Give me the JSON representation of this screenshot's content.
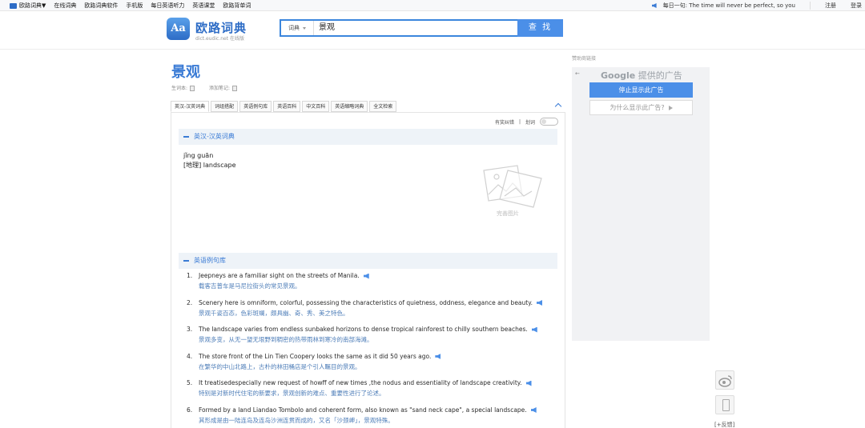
{
  "topbar": {
    "nav": [
      "欧路词典▼",
      "在线词典",
      "欧路词典软件",
      "手机版",
      "每日英语听力",
      "英语课堂",
      "欧路背单词"
    ],
    "daily": "每日一句: The time will never be perfect, so you",
    "register": "注册",
    "login": "登录"
  },
  "brand": {
    "icon_text": "Aa",
    "name": "欧路词典",
    "sub": "dict.eudic.net 在线版"
  },
  "search": {
    "scope": "词典",
    "query": "景观",
    "button": "查 找"
  },
  "word": {
    "title": "景观",
    "wordbook": "生词本:",
    "note": "添加笔记:"
  },
  "tabs": [
    "英汉-汉英词典",
    "词组搭配",
    "英语例句库",
    "英语百科",
    "中文百科",
    "英语缩略词典",
    "全文检索"
  ],
  "panel": {
    "tools": [
      "有奖纠错",
      "|",
      "划词"
    ],
    "section1": "英汉-汉英词典",
    "pinyin": "jǐng guān",
    "definition": "[地理] landscape",
    "pic_label": "完善图片",
    "section2": "英语例句库"
  },
  "examples": [
    {
      "num": "1.",
      "en": "Jeepneys are a familiar sight on the streets of Manila.",
      "zh": "载客吉普车是马尼拉街头的常见景观。"
    },
    {
      "num": "2.",
      "en": "Scenery here is omniform, colorful, possessing the characteristics of quietness, oddness, elegance and beauty.",
      "zh": "景观千姿百态，色彩斑斓，颇具幽、奇、秀、美之特色。"
    },
    {
      "num": "3.",
      "en": "The landscape varies from endless sunbaked horizons to dense tropical rainforest to chilly southern beaches.",
      "zh": "景观多变，从无一望无垠野到稠密的热带雨林到寒冷的南部海滩。"
    },
    {
      "num": "4.",
      "en": "The store front of the Lin Tien Coopery looks the same as it did 50 years ago.",
      "zh": "在繁华的中山北路上，古朴的林田桶店是个引人瞩目的景观。"
    },
    {
      "num": "5.",
      "en": "It treatisedespecially new request of howff of new times ,the nodus and essentiality of landscape creativity.",
      "zh": "特别是对新时代住宅的新要求，景观创新的难点、重要性进行了论述。"
    },
    {
      "num": "6.",
      "en": "Formed by a land Liandao Tombolo and coherent form, also known as \"sand neck cape\", a special landscape.",
      "zh": "其形成是由一陆连岛及连岛沙洲连贯而成的，又名「沙颈岬」，景观特殊。"
    }
  ],
  "ad": {
    "label": "赞助商链接",
    "back": "←",
    "google": "Google",
    "provided": " 提供的广告",
    "stop": "停止显示此广告",
    "why": "为什么显示此广告?"
  },
  "side": {
    "feedback": "[+反馈]"
  },
  "colors": {
    "accent": "#3a7bd5",
    "button": "#4b8fe8",
    "section_bg": "#eef3f8"
  }
}
